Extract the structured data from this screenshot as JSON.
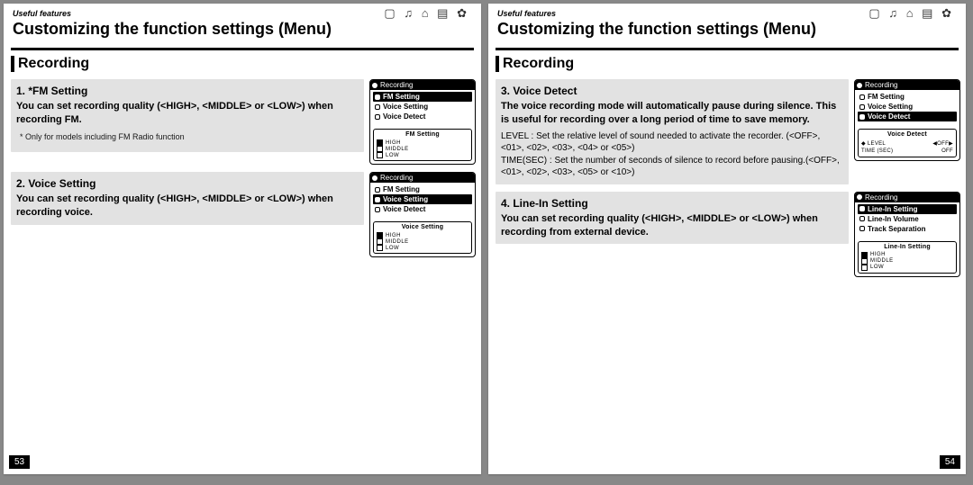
{
  "pages": [
    {
      "number": "53",
      "crumb": "Useful features",
      "title": "Customizing the function settings (Menu)",
      "section": "Recording",
      "blocks": [
        {
          "heading": "1. *FM Setting",
          "desc": "You can set recording quality (<HIGH>, <MIDDLE> or <LOW>) when recording FM.",
          "footnote": "* Only for models including FM Radio function",
          "lcd": {
            "title": "Recording",
            "items": [
              "FM Setting",
              "Voice Setting",
              "Voice Detect"
            ],
            "selected": 0,
            "subtitle": "FM Setting",
            "options": [
              {
                "label": "HIGH",
                "filled": true
              },
              {
                "label": "MIDDLE",
                "filled": false
              },
              {
                "label": "LOW",
                "filled": false
              }
            ]
          }
        },
        {
          "heading": "2. Voice Setting",
          "desc": "You can set recording quality (<HIGH>, <MIDDLE> or <LOW>) when recording voice.",
          "footnote": "",
          "lcd": {
            "title": "Recording",
            "items": [
              "FM Setting",
              "Voice Setting",
              "Voice Detect"
            ],
            "selected": 1,
            "subtitle": "Voice Setting",
            "options": [
              {
                "label": "HIGH",
                "filled": true
              },
              {
                "label": "MIDDLE",
                "filled": false
              },
              {
                "label": "LOW",
                "filled": false
              }
            ]
          }
        }
      ]
    },
    {
      "number": "54",
      "crumb": "Useful features",
      "title": "Customizing the function settings (Menu)",
      "section": "Recording",
      "blocks": [
        {
          "heading": "3. Voice Detect",
          "desc": "The voice recording mode will automatically pause during silence. This is useful for recording over a long period of time to save memory.",
          "sub": "LEVEL : Set the relative level of sound needed to activate the recorder. (<OFF>, <01>, <02>, <03>, <04> or <05>)\nTIME(SEC) : Set the number of seconds of silence to record before pausing.(<OFF>, <01>, <02>, <03>, <05> or <10>)",
          "lcd": {
            "title": "Recording",
            "items": [
              "FM Setting",
              "Voice Setting",
              "Voice Detect"
            ],
            "selected": 2,
            "subtitle": "Voice Detect",
            "vd_rows": [
              {
                "left": "LEVEL",
                "right": "OFF"
              },
              {
                "left": "TIME (SEC)",
                "right": "OFF"
              }
            ]
          }
        },
        {
          "heading": "4. Line-In Setting",
          "desc": "You can set recording quality (<HIGH>, <MIDDLE> or <LOW>) when recording from external device.",
          "lcd": {
            "title": "Recording",
            "items": [
              "Line-In Setting",
              "Line-In Volume",
              "Track Separation"
            ],
            "selected": 0,
            "subtitle": "Line-In Setting",
            "options": [
              {
                "label": "HIGH",
                "filled": true
              },
              {
                "label": "MIDDLE",
                "filled": false
              },
              {
                "label": "LOW",
                "filled": false
              }
            ]
          }
        }
      ]
    }
  ]
}
